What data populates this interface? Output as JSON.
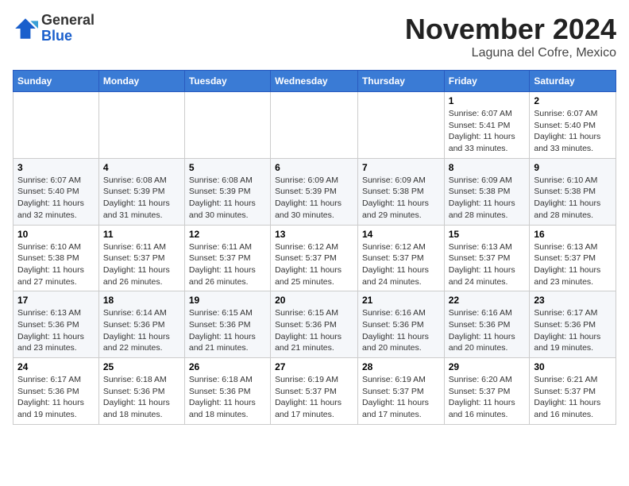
{
  "logo": {
    "general": "General",
    "blue": "Blue"
  },
  "header": {
    "month": "November 2024",
    "location": "Laguna del Cofre, Mexico"
  },
  "weekdays": [
    "Sunday",
    "Monday",
    "Tuesday",
    "Wednesday",
    "Thursday",
    "Friday",
    "Saturday"
  ],
  "weeks": [
    [
      {
        "day": "",
        "info": ""
      },
      {
        "day": "",
        "info": ""
      },
      {
        "day": "",
        "info": ""
      },
      {
        "day": "",
        "info": ""
      },
      {
        "day": "",
        "info": ""
      },
      {
        "day": "1",
        "info": "Sunrise: 6:07 AM\nSunset: 5:41 PM\nDaylight: 11 hours and 33 minutes."
      },
      {
        "day": "2",
        "info": "Sunrise: 6:07 AM\nSunset: 5:40 PM\nDaylight: 11 hours and 33 minutes."
      }
    ],
    [
      {
        "day": "3",
        "info": "Sunrise: 6:07 AM\nSunset: 5:40 PM\nDaylight: 11 hours and 32 minutes."
      },
      {
        "day": "4",
        "info": "Sunrise: 6:08 AM\nSunset: 5:39 PM\nDaylight: 11 hours and 31 minutes."
      },
      {
        "day": "5",
        "info": "Sunrise: 6:08 AM\nSunset: 5:39 PM\nDaylight: 11 hours and 30 minutes."
      },
      {
        "day": "6",
        "info": "Sunrise: 6:09 AM\nSunset: 5:39 PM\nDaylight: 11 hours and 30 minutes."
      },
      {
        "day": "7",
        "info": "Sunrise: 6:09 AM\nSunset: 5:38 PM\nDaylight: 11 hours and 29 minutes."
      },
      {
        "day": "8",
        "info": "Sunrise: 6:09 AM\nSunset: 5:38 PM\nDaylight: 11 hours and 28 minutes."
      },
      {
        "day": "9",
        "info": "Sunrise: 6:10 AM\nSunset: 5:38 PM\nDaylight: 11 hours and 28 minutes."
      }
    ],
    [
      {
        "day": "10",
        "info": "Sunrise: 6:10 AM\nSunset: 5:38 PM\nDaylight: 11 hours and 27 minutes."
      },
      {
        "day": "11",
        "info": "Sunrise: 6:11 AM\nSunset: 5:37 PM\nDaylight: 11 hours and 26 minutes."
      },
      {
        "day": "12",
        "info": "Sunrise: 6:11 AM\nSunset: 5:37 PM\nDaylight: 11 hours and 26 minutes."
      },
      {
        "day": "13",
        "info": "Sunrise: 6:12 AM\nSunset: 5:37 PM\nDaylight: 11 hours and 25 minutes."
      },
      {
        "day": "14",
        "info": "Sunrise: 6:12 AM\nSunset: 5:37 PM\nDaylight: 11 hours and 24 minutes."
      },
      {
        "day": "15",
        "info": "Sunrise: 6:13 AM\nSunset: 5:37 PM\nDaylight: 11 hours and 24 minutes."
      },
      {
        "day": "16",
        "info": "Sunrise: 6:13 AM\nSunset: 5:37 PM\nDaylight: 11 hours and 23 minutes."
      }
    ],
    [
      {
        "day": "17",
        "info": "Sunrise: 6:13 AM\nSunset: 5:36 PM\nDaylight: 11 hours and 23 minutes."
      },
      {
        "day": "18",
        "info": "Sunrise: 6:14 AM\nSunset: 5:36 PM\nDaylight: 11 hours and 22 minutes."
      },
      {
        "day": "19",
        "info": "Sunrise: 6:15 AM\nSunset: 5:36 PM\nDaylight: 11 hours and 21 minutes."
      },
      {
        "day": "20",
        "info": "Sunrise: 6:15 AM\nSunset: 5:36 PM\nDaylight: 11 hours and 21 minutes."
      },
      {
        "day": "21",
        "info": "Sunrise: 6:16 AM\nSunset: 5:36 PM\nDaylight: 11 hours and 20 minutes."
      },
      {
        "day": "22",
        "info": "Sunrise: 6:16 AM\nSunset: 5:36 PM\nDaylight: 11 hours and 20 minutes."
      },
      {
        "day": "23",
        "info": "Sunrise: 6:17 AM\nSunset: 5:36 PM\nDaylight: 11 hours and 19 minutes."
      }
    ],
    [
      {
        "day": "24",
        "info": "Sunrise: 6:17 AM\nSunset: 5:36 PM\nDaylight: 11 hours and 19 minutes."
      },
      {
        "day": "25",
        "info": "Sunrise: 6:18 AM\nSunset: 5:36 PM\nDaylight: 11 hours and 18 minutes."
      },
      {
        "day": "26",
        "info": "Sunrise: 6:18 AM\nSunset: 5:36 PM\nDaylight: 11 hours and 18 minutes."
      },
      {
        "day": "27",
        "info": "Sunrise: 6:19 AM\nSunset: 5:37 PM\nDaylight: 11 hours and 17 minutes."
      },
      {
        "day": "28",
        "info": "Sunrise: 6:19 AM\nSunset: 5:37 PM\nDaylight: 11 hours and 17 minutes."
      },
      {
        "day": "29",
        "info": "Sunrise: 6:20 AM\nSunset: 5:37 PM\nDaylight: 11 hours and 16 minutes."
      },
      {
        "day": "30",
        "info": "Sunrise: 6:21 AM\nSunset: 5:37 PM\nDaylight: 11 hours and 16 minutes."
      }
    ]
  ]
}
